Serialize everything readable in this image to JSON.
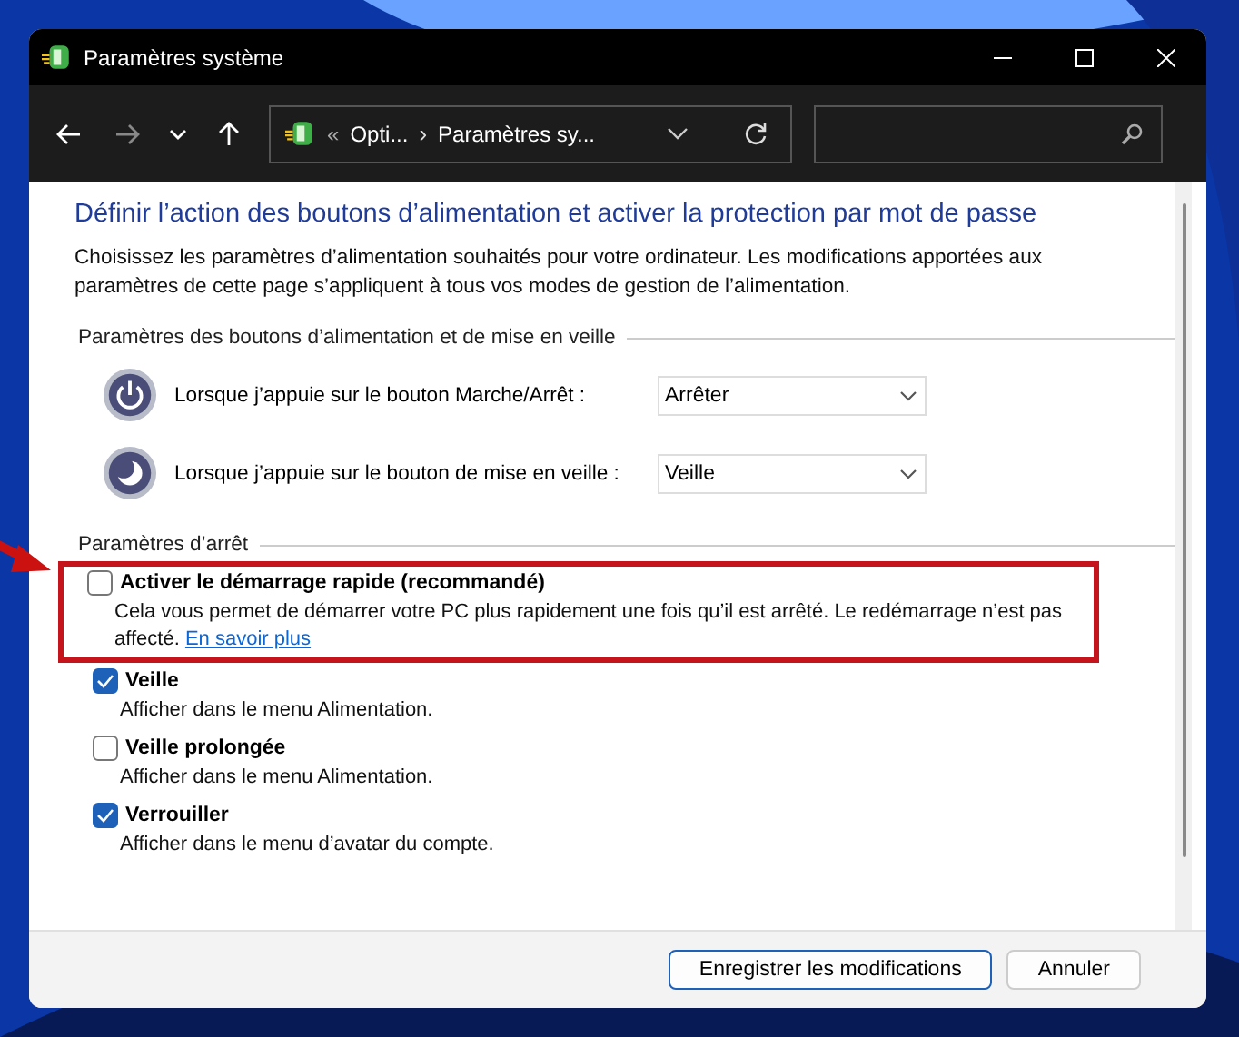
{
  "window": {
    "title": "Paramètres système"
  },
  "address_bar": {
    "overflow": "«",
    "crumbs": [
      "Opti...",
      "Paramètres sy..."
    ],
    "separator": "›"
  },
  "heading": "Définir l’action des boutons d’alimentation et activer la protection par mot de passe",
  "intro": "Choisissez les paramètres d’alimentation souhaités pour votre ordinateur. Les modifications apportées aux paramètres de cette page s’appliquent à tous vos modes de gestion de l’alimentation.",
  "button_section": {
    "title": "Paramètres des boutons d’alimentation et de mise en veille",
    "rows": [
      {
        "kind": "power",
        "label": "Lorsque j’appuie sur le bouton Marche/Arrêt :",
        "value": "Arrêter"
      },
      {
        "kind": "sleep",
        "label": "Lorsque j’appuie sur le bouton de mise en veille :",
        "value": "Veille"
      }
    ]
  },
  "shutdown_section": {
    "title": "Paramètres d’arrêt",
    "options": [
      {
        "label": "Activer le démarrage rapide (recommandé)",
        "checked": false,
        "highlighted": true,
        "description": "Cela vous permet de démarrer votre PC plus rapidement une fois qu’il est arrêté. Le redémarrage n’est pas affecté.",
        "link": "En savoir plus"
      },
      {
        "label": "Veille",
        "checked": true,
        "highlighted": false,
        "description": "Afficher dans le menu Alimentation."
      },
      {
        "label": "Veille prolongée",
        "checked": false,
        "highlighted": false,
        "description": "Afficher dans le menu Alimentation."
      },
      {
        "label": "Verrouiller",
        "checked": true,
        "highlighted": false,
        "description": "Afficher dans le menu d’avatar du compte."
      }
    ]
  },
  "buttons": [
    {
      "label": "Enregistrer les modifications",
      "default": true
    },
    {
      "label": "Annuler",
      "default": false
    }
  ]
}
